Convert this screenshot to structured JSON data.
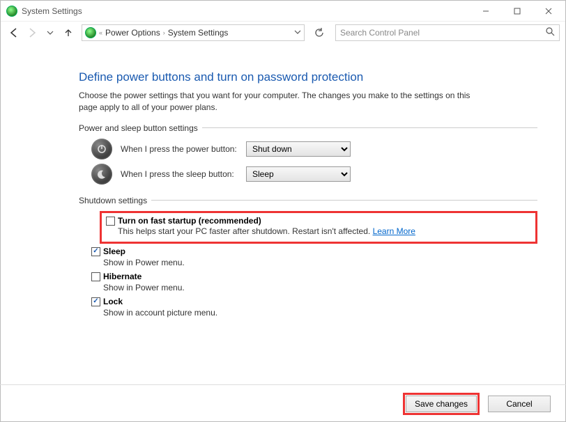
{
  "window": {
    "title": "System Settings"
  },
  "breadcrumb": {
    "level1": "Power Options",
    "level2": "System Settings"
  },
  "search": {
    "placeholder": "Search Control Panel"
  },
  "page": {
    "title": "Define power buttons and turn on password protection",
    "description": "Choose the power settings that you want for your computer. The changes you make to the settings on this page apply to all of your power plans."
  },
  "section_power": {
    "label": "Power and sleep button settings",
    "power_btn_label": "When I press the power button:",
    "power_btn_value": "Shut down",
    "sleep_btn_label": "When I press the sleep button:",
    "sleep_btn_value": "Sleep"
  },
  "section_shutdown": {
    "label": "Shutdown settings",
    "fast_startup": {
      "title": "Turn on fast startup (recommended)",
      "desc": "This helps start your PC faster after shutdown. Restart isn't affected. ",
      "link": "Learn More",
      "checked": false
    },
    "sleep": {
      "title": "Sleep",
      "desc": "Show in Power menu.",
      "checked": true
    },
    "hibernate": {
      "title": "Hibernate",
      "desc": "Show in Power menu.",
      "checked": false
    },
    "lock": {
      "title": "Lock",
      "desc": "Show in account picture menu.",
      "checked": true
    }
  },
  "footer": {
    "save": "Save changes",
    "cancel": "Cancel"
  }
}
